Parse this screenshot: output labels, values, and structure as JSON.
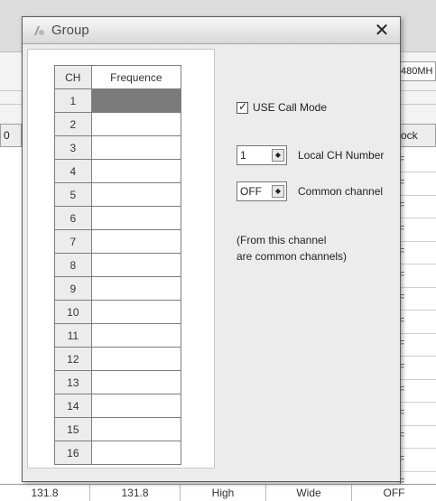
{
  "background": {
    "field_value": "480MH",
    "headers": [
      "0",
      "ock"
    ],
    "f_marks": [
      "F",
      "F",
      "F",
      "F",
      "F",
      "F",
      "F",
      "F",
      "F",
      "F",
      "F",
      "F",
      "F",
      "F",
      "F"
    ],
    "bottom_row": [
      "131.8",
      "131.8",
      "High",
      "Wide",
      "OFF"
    ]
  },
  "dialog": {
    "title": "Group",
    "close_icon": "✕",
    "table": {
      "headers": {
        "ch": "CH",
        "freq": "Frequence"
      },
      "rows": [
        "1",
        "2",
        "3",
        "4",
        "5",
        "6",
        "7",
        "8",
        "9",
        "10",
        "11",
        "12",
        "13",
        "14",
        "15",
        "16"
      ],
      "selected_row": 1
    },
    "use_call_mode": {
      "label": "USE Call Mode",
      "checked": true
    },
    "local_ch": {
      "value": "1",
      "label": "Local CH Number"
    },
    "common_channel": {
      "value": "OFF",
      "label": "Common channel"
    },
    "note": {
      "line1": "(From this channel",
      "line2": "are common channels)"
    }
  }
}
